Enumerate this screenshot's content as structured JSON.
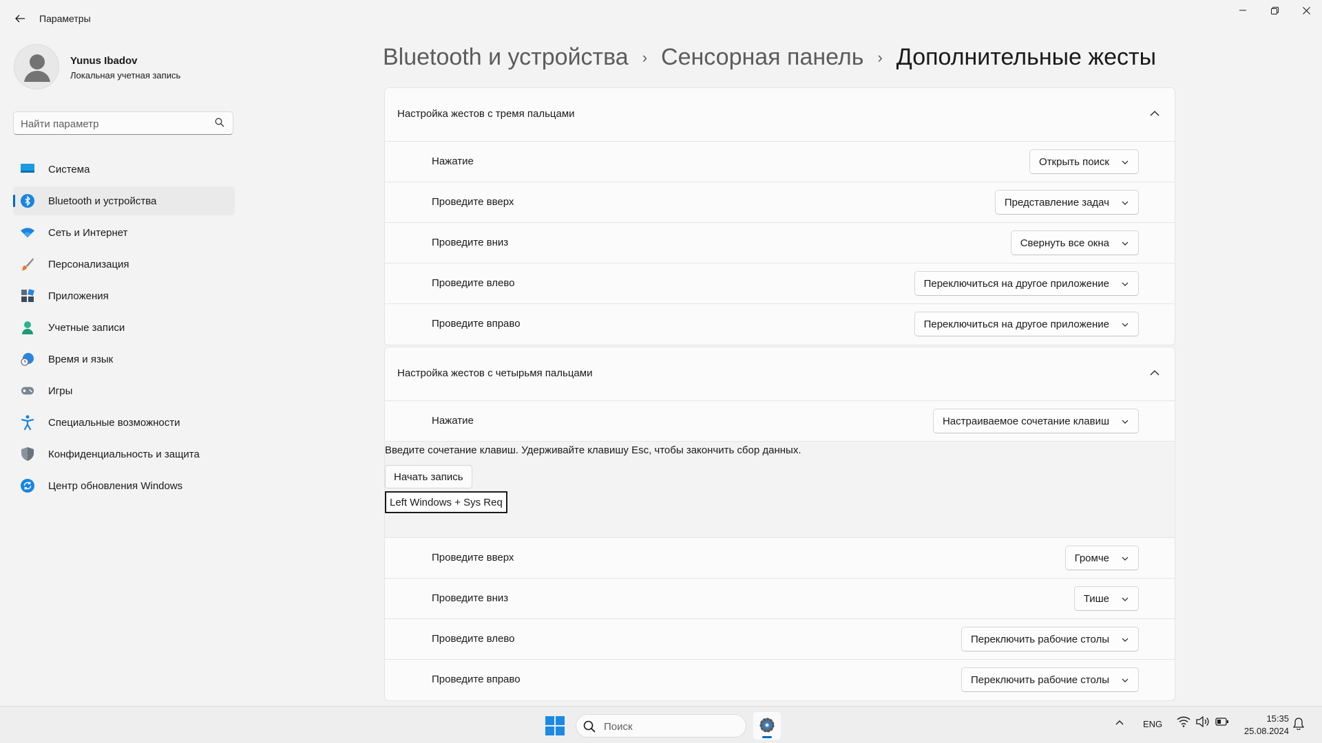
{
  "app": {
    "title": "Параметры"
  },
  "user": {
    "name": "Yunus Ibadov",
    "account_type": "Локальная учетная запись"
  },
  "search": {
    "placeholder": "Найти параметр"
  },
  "sidebar": {
    "items": [
      {
        "label": "Система",
        "icon": "system-icon"
      },
      {
        "label": "Bluetooth и устройства",
        "icon": "bluetooth-icon",
        "active": true
      },
      {
        "label": "Сеть и Интернет",
        "icon": "wifi-icon"
      },
      {
        "label": "Персонализация",
        "icon": "brush-icon"
      },
      {
        "label": "Приложения",
        "icon": "apps-icon"
      },
      {
        "label": "Учетные записи",
        "icon": "person-icon"
      },
      {
        "label": "Время и язык",
        "icon": "globe-clock-icon"
      },
      {
        "label": "Игры",
        "icon": "gamepad-icon"
      },
      {
        "label": "Специальные возможности",
        "icon": "accessibility-icon"
      },
      {
        "label": "Конфиденциальность и защита",
        "icon": "shield-icon"
      },
      {
        "label": "Центр обновления Windows",
        "icon": "update-icon"
      }
    ]
  },
  "breadcrumb": {
    "items": [
      "Bluetooth и устройства",
      "Сенсорная панель"
    ],
    "current": "Дополнительные жесты"
  },
  "three_finger": {
    "title": "Настройка жестов с тремя пальцами",
    "rows": [
      {
        "label": "Нажатие",
        "value": "Открыть поиск"
      },
      {
        "label": "Проведите вверх",
        "value": "Представление задач"
      },
      {
        "label": "Проведите вниз",
        "value": "Свернуть все окна"
      },
      {
        "label": "Проведите влево",
        "value": "Переключиться на другое приложение"
      },
      {
        "label": "Проведите вправо",
        "value": "Переключиться на другое приложение"
      }
    ]
  },
  "four_finger": {
    "title": "Настройка жестов с четырьмя пальцами",
    "tap": {
      "label": "Нажатие",
      "value": "Настраиваемое сочетание клавиш"
    },
    "recorder": {
      "hint": "Введите сочетание клавиш. Удерживайте клавишу Esc, чтобы закончить сбор данных.",
      "button": "Начать запись",
      "shortcut": "Left Windows + Sys Req"
    },
    "rows": [
      {
        "label": "Проведите вверх",
        "value": "Громче"
      },
      {
        "label": "Проведите вниз",
        "value": "Тише"
      },
      {
        "label": "Проведите влево",
        "value": "Переключить рабочие столы"
      },
      {
        "label": "Проведите вправо",
        "value": "Переключить рабочие столы"
      }
    ]
  },
  "taskbar": {
    "search_placeholder": "Поиск",
    "language": "ENG",
    "time": "15:35",
    "date": "25.08.2024"
  },
  "colors": {
    "accent": "#0067c0",
    "background": "#f3f3f3",
    "card": "#fbfbfb"
  }
}
